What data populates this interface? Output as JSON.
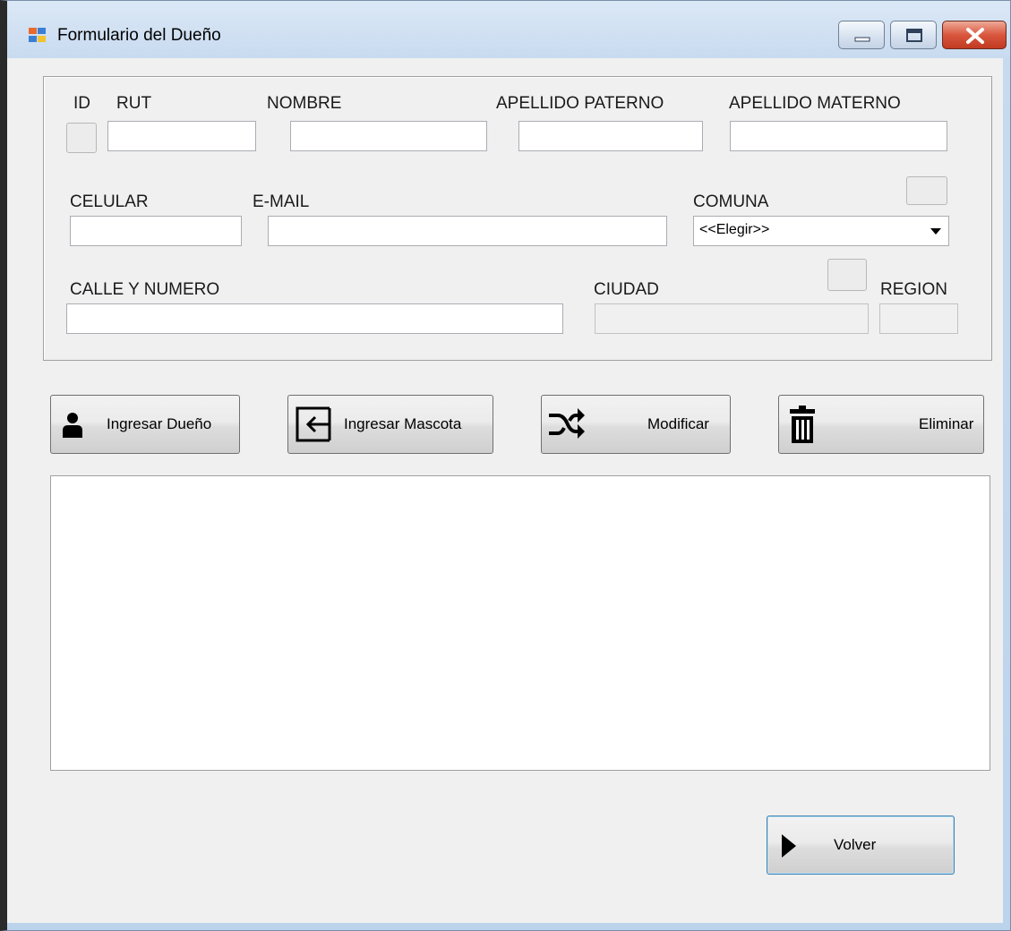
{
  "window": {
    "title": "Formulario del Dueño"
  },
  "form": {
    "labels": {
      "id": "ID",
      "rut": "RUT",
      "nombre": "NOMBRE",
      "apellido_paterno": "APELLIDO PATERNO",
      "apellido_materno": "APELLIDO MATERNO",
      "celular": "CELULAR",
      "email": "E-MAIL",
      "comuna": "COMUNA",
      "calle_numero": "CALLE Y NUMERO",
      "ciudad": "CIUDAD",
      "region": "REGION"
    },
    "values": {
      "id": "",
      "rut": "",
      "nombre": "",
      "apellido_paterno": "",
      "apellido_materno": "",
      "celular": "",
      "email": "",
      "calle_numero": "",
      "ciudad": "",
      "region": ""
    },
    "comuna_selected": "<<Elegir>>"
  },
  "actions": {
    "ingresar_dueno": "Ingresar Dueño",
    "ingresar_mascota": "Ingresar Mascota",
    "modificar": "Modificar",
    "eliminar": "Eliminar",
    "volver": "Volver"
  },
  "icons": {
    "app": "form-app-icon",
    "ingresar_dueno": "person-icon",
    "ingresar_mascota": "sign-in-icon",
    "modificar": "shuffle-icon",
    "eliminar": "trash-icon",
    "volver": "play-triangle-icon"
  },
  "colors": {
    "close_button": "#c13a22",
    "form_background": "#f0f0f0",
    "focus_border": "#3c7fb1"
  }
}
